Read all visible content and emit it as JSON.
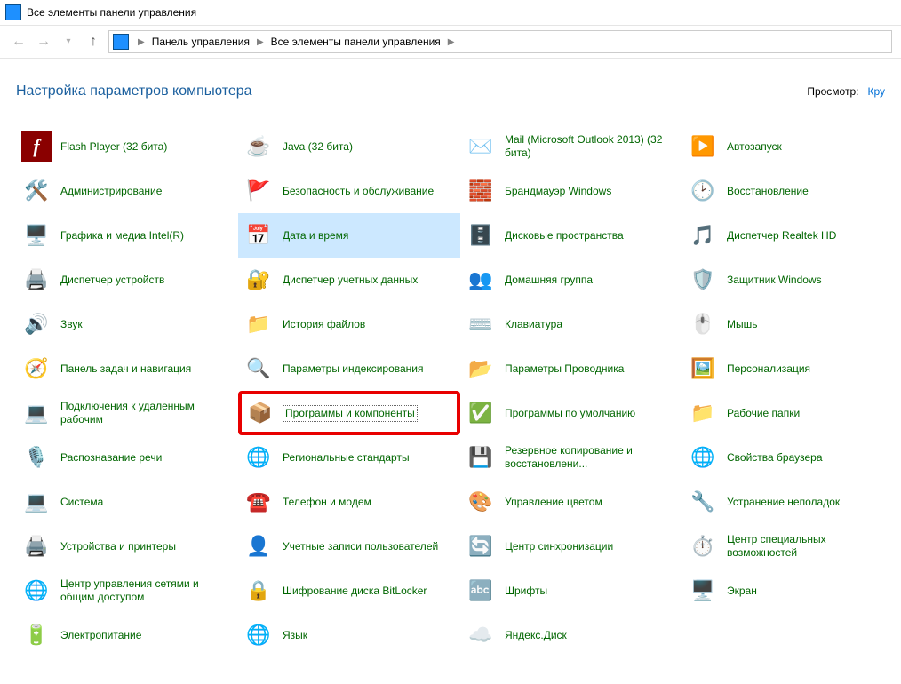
{
  "window": {
    "title": "Все элементы панели управления"
  },
  "breadcrumbs": {
    "seg1": "Панель управления",
    "seg2": "Все элементы панели управления"
  },
  "header": {
    "title": "Настройка параметров компьютера",
    "view_label": "Просмотр:",
    "view_value": "Кру"
  },
  "items": [
    {
      "label": "Flash Player (32 бита)",
      "icon": "flash-icon",
      "glyph": "f",
      "cls": "ic-flash"
    },
    {
      "label": "Java (32 бита)",
      "icon": "java-icon",
      "glyph": "☕"
    },
    {
      "label": "Mail (Microsoft Outlook 2013) (32 бита)",
      "icon": "mail-icon",
      "glyph": "✉️"
    },
    {
      "label": "Автозапуск",
      "icon": "autoplay-icon",
      "glyph": "▶️"
    },
    {
      "label": "Администрирование",
      "icon": "admin-tools-icon",
      "glyph": "🛠️"
    },
    {
      "label": "Безопасность и обслуживание",
      "icon": "security-maint-icon",
      "glyph": "🚩"
    },
    {
      "label": "Брандмауэр Windows",
      "icon": "firewall-icon",
      "glyph": "🧱"
    },
    {
      "label": "Восстановление",
      "icon": "recovery-icon",
      "glyph": "🕑"
    },
    {
      "label": "Графика и медиа Intel(R)",
      "icon": "intel-graphics-icon",
      "glyph": "🖥️"
    },
    {
      "label": "Дата и время",
      "icon": "date-time-icon",
      "glyph": "📅",
      "hovered": true
    },
    {
      "label": "Дисковые пространства",
      "icon": "storage-spaces-icon",
      "glyph": "🗄️"
    },
    {
      "label": "Диспетчер Realtek HD",
      "icon": "realtek-icon",
      "glyph": "🎵"
    },
    {
      "label": "Диспетчер устройств",
      "icon": "device-manager-icon",
      "glyph": "🖨️"
    },
    {
      "label": "Диспетчер учетных данных",
      "icon": "credential-mgr-icon",
      "glyph": "🔐"
    },
    {
      "label": "Домашняя группа",
      "icon": "homegroup-icon",
      "glyph": "👥"
    },
    {
      "label": "Защитник Windows",
      "icon": "defender-icon",
      "glyph": "🛡️"
    },
    {
      "label": "Звук",
      "icon": "sound-icon",
      "glyph": "🔊"
    },
    {
      "label": "История файлов",
      "icon": "file-history-icon",
      "glyph": "📁"
    },
    {
      "label": "Клавиатура",
      "icon": "keyboard-icon",
      "glyph": "⌨️"
    },
    {
      "label": "Мышь",
      "icon": "mouse-icon",
      "glyph": "🖱️"
    },
    {
      "label": "Панель задач и навигация",
      "icon": "taskbar-icon",
      "glyph": "🧭"
    },
    {
      "label": "Параметры индексирования",
      "icon": "indexing-icon",
      "glyph": "🔍"
    },
    {
      "label": "Параметры Проводника",
      "icon": "explorer-options-icon",
      "glyph": "📂"
    },
    {
      "label": "Персонализация",
      "icon": "personalization-icon",
      "glyph": "🖼️"
    },
    {
      "label": "Подключения к удаленным рабочим",
      "icon": "remote-app-icon",
      "glyph": "💻"
    },
    {
      "label": "Программы и компоненты",
      "icon": "programs-features-icon",
      "glyph": "📦",
      "highlight": true
    },
    {
      "label": "Программы по умолчанию",
      "icon": "default-programs-icon",
      "glyph": "✅"
    },
    {
      "label": "Рабочие папки",
      "icon": "work-folders-icon",
      "glyph": "📁"
    },
    {
      "label": "Распознавание речи",
      "icon": "speech-icon",
      "glyph": "🎙️"
    },
    {
      "label": "Региональные стандарты",
      "icon": "region-icon",
      "glyph": "🌐"
    },
    {
      "label": "Резервное копирование и восстановлени...",
      "icon": "backup-restore-icon",
      "glyph": "💾"
    },
    {
      "label": "Свойства браузера",
      "icon": "internet-options-icon",
      "glyph": "🌐"
    },
    {
      "label": "Система",
      "icon": "system-icon",
      "glyph": "💻"
    },
    {
      "label": "Телефон и модем",
      "icon": "phone-modem-icon",
      "glyph": "☎️"
    },
    {
      "label": "Управление цветом",
      "icon": "color-mgmt-icon",
      "glyph": "🎨"
    },
    {
      "label": "Устранение неполадок",
      "icon": "troubleshoot-icon",
      "glyph": "🔧"
    },
    {
      "label": "Устройства и принтеры",
      "icon": "devices-printers-icon",
      "glyph": "🖨️"
    },
    {
      "label": "Учетные записи пользователей",
      "icon": "user-accounts-icon",
      "glyph": "👤"
    },
    {
      "label": "Центр синхронизации",
      "icon": "sync-center-icon",
      "glyph": "🔄"
    },
    {
      "label": "Центр специальных возможностей",
      "icon": "ease-of-access-icon",
      "glyph": "⏱️"
    },
    {
      "label": "Центр управления сетями и общим доступом",
      "icon": "network-sharing-icon",
      "glyph": "🌐"
    },
    {
      "label": "Шифрование диска BitLocker",
      "icon": "bitlocker-icon",
      "glyph": "🔒"
    },
    {
      "label": "Шрифты",
      "icon": "fonts-icon",
      "glyph": "🔤"
    },
    {
      "label": "Экран",
      "icon": "display-icon",
      "glyph": "🖥️"
    },
    {
      "label": "Электропитание",
      "icon": "power-options-icon",
      "glyph": "🔋"
    },
    {
      "label": "Язык",
      "icon": "language-icon",
      "glyph": "🌐"
    },
    {
      "label": "Яндекс.Диск",
      "icon": "yandex-disk-icon",
      "glyph": "☁️"
    }
  ]
}
